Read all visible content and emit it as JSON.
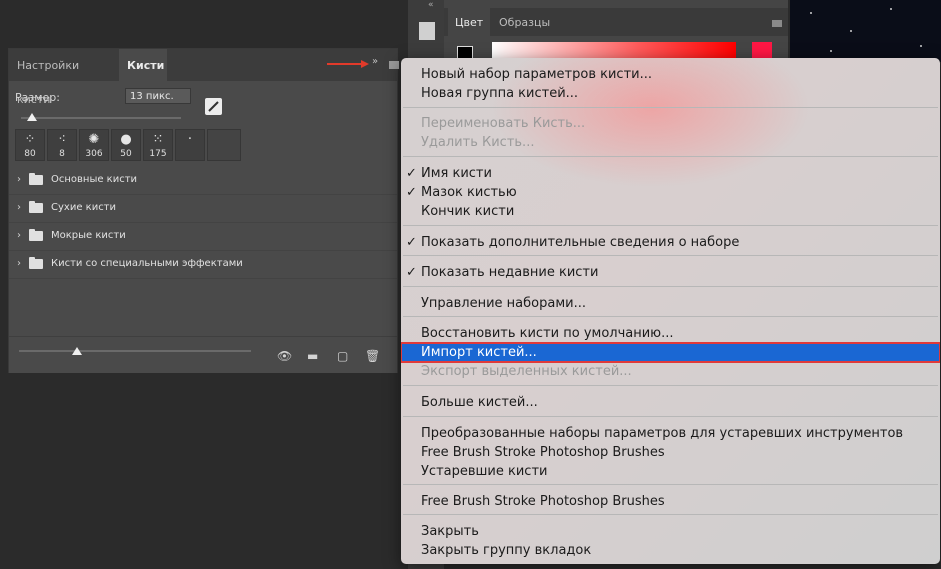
{
  "brush_panel": {
    "tabs": [
      "Настройки кисти",
      "Кисти"
    ],
    "menu_arrows": "»",
    "size_label": "Размер:",
    "size_value": "13 пикс.",
    "size_slider_level": 0.07,
    "presets": [
      {
        "num": "80"
      },
      {
        "num": "8"
      },
      {
        "num": "306"
      },
      {
        "num": "50"
      },
      {
        "num": "175"
      },
      {
        "num": ""
      }
    ],
    "groups": [
      "Основные кисти",
      "Сухие кисти",
      "Мокрые кисти",
      "Кисти со специальными эффектами"
    ],
    "preview_slider_level": 0.25
  },
  "color_panel": {
    "tabs": [
      "Цвет",
      "Образцы"
    ],
    "collapse": "«"
  },
  "menu": {
    "items": [
      {
        "label": "Новый набор параметров кисти...",
        "state": "normal",
        "check": ""
      },
      {
        "label": "Новая группа кистей...",
        "state": "normal",
        "check": ""
      },
      {
        "label": "Переименовать Кисть...",
        "state": "disabled",
        "check": ""
      },
      {
        "label": "Удалить Кисть...",
        "state": "disabled",
        "check": ""
      },
      {
        "label": "Имя кисти",
        "state": "normal",
        "check": "✓"
      },
      {
        "label": "Мазок кистью",
        "state": "normal",
        "check": "✓"
      },
      {
        "label": "Кончик кисти",
        "state": "normal",
        "check": ""
      },
      {
        "label": "Показать дополнительные сведения о наборе",
        "state": "normal",
        "check": "✓"
      },
      {
        "label": "Показать недавние кисти",
        "state": "normal",
        "check": "✓"
      },
      {
        "label": "Управление наборами...",
        "state": "normal",
        "check": ""
      },
      {
        "label": "Восстановить кисти по умолчанию...",
        "state": "normal",
        "check": ""
      },
      {
        "label": "Импорт кистей...",
        "state": "highlighted",
        "check": ""
      },
      {
        "label": "Экспорт выделенных кистей...",
        "state": "disabled",
        "check": ""
      },
      {
        "label": "Больше кистей...",
        "state": "normal",
        "check": ""
      },
      {
        "label": "Преобразованные наборы параметров для устаревших инструментов",
        "state": "normal",
        "check": ""
      },
      {
        "label": "Free Brush Stroke Photoshop Brushes",
        "state": "normal",
        "check": ""
      },
      {
        "label": "Устаревшие кисти",
        "state": "normal",
        "check": ""
      },
      {
        "label": "Free Brush Stroke Photoshop Brushes",
        "state": "normal",
        "check": ""
      },
      {
        "label": "Закрыть",
        "state": "normal",
        "check": ""
      },
      {
        "label": "Закрыть группу вкладок",
        "state": "normal",
        "check": ""
      }
    ]
  }
}
